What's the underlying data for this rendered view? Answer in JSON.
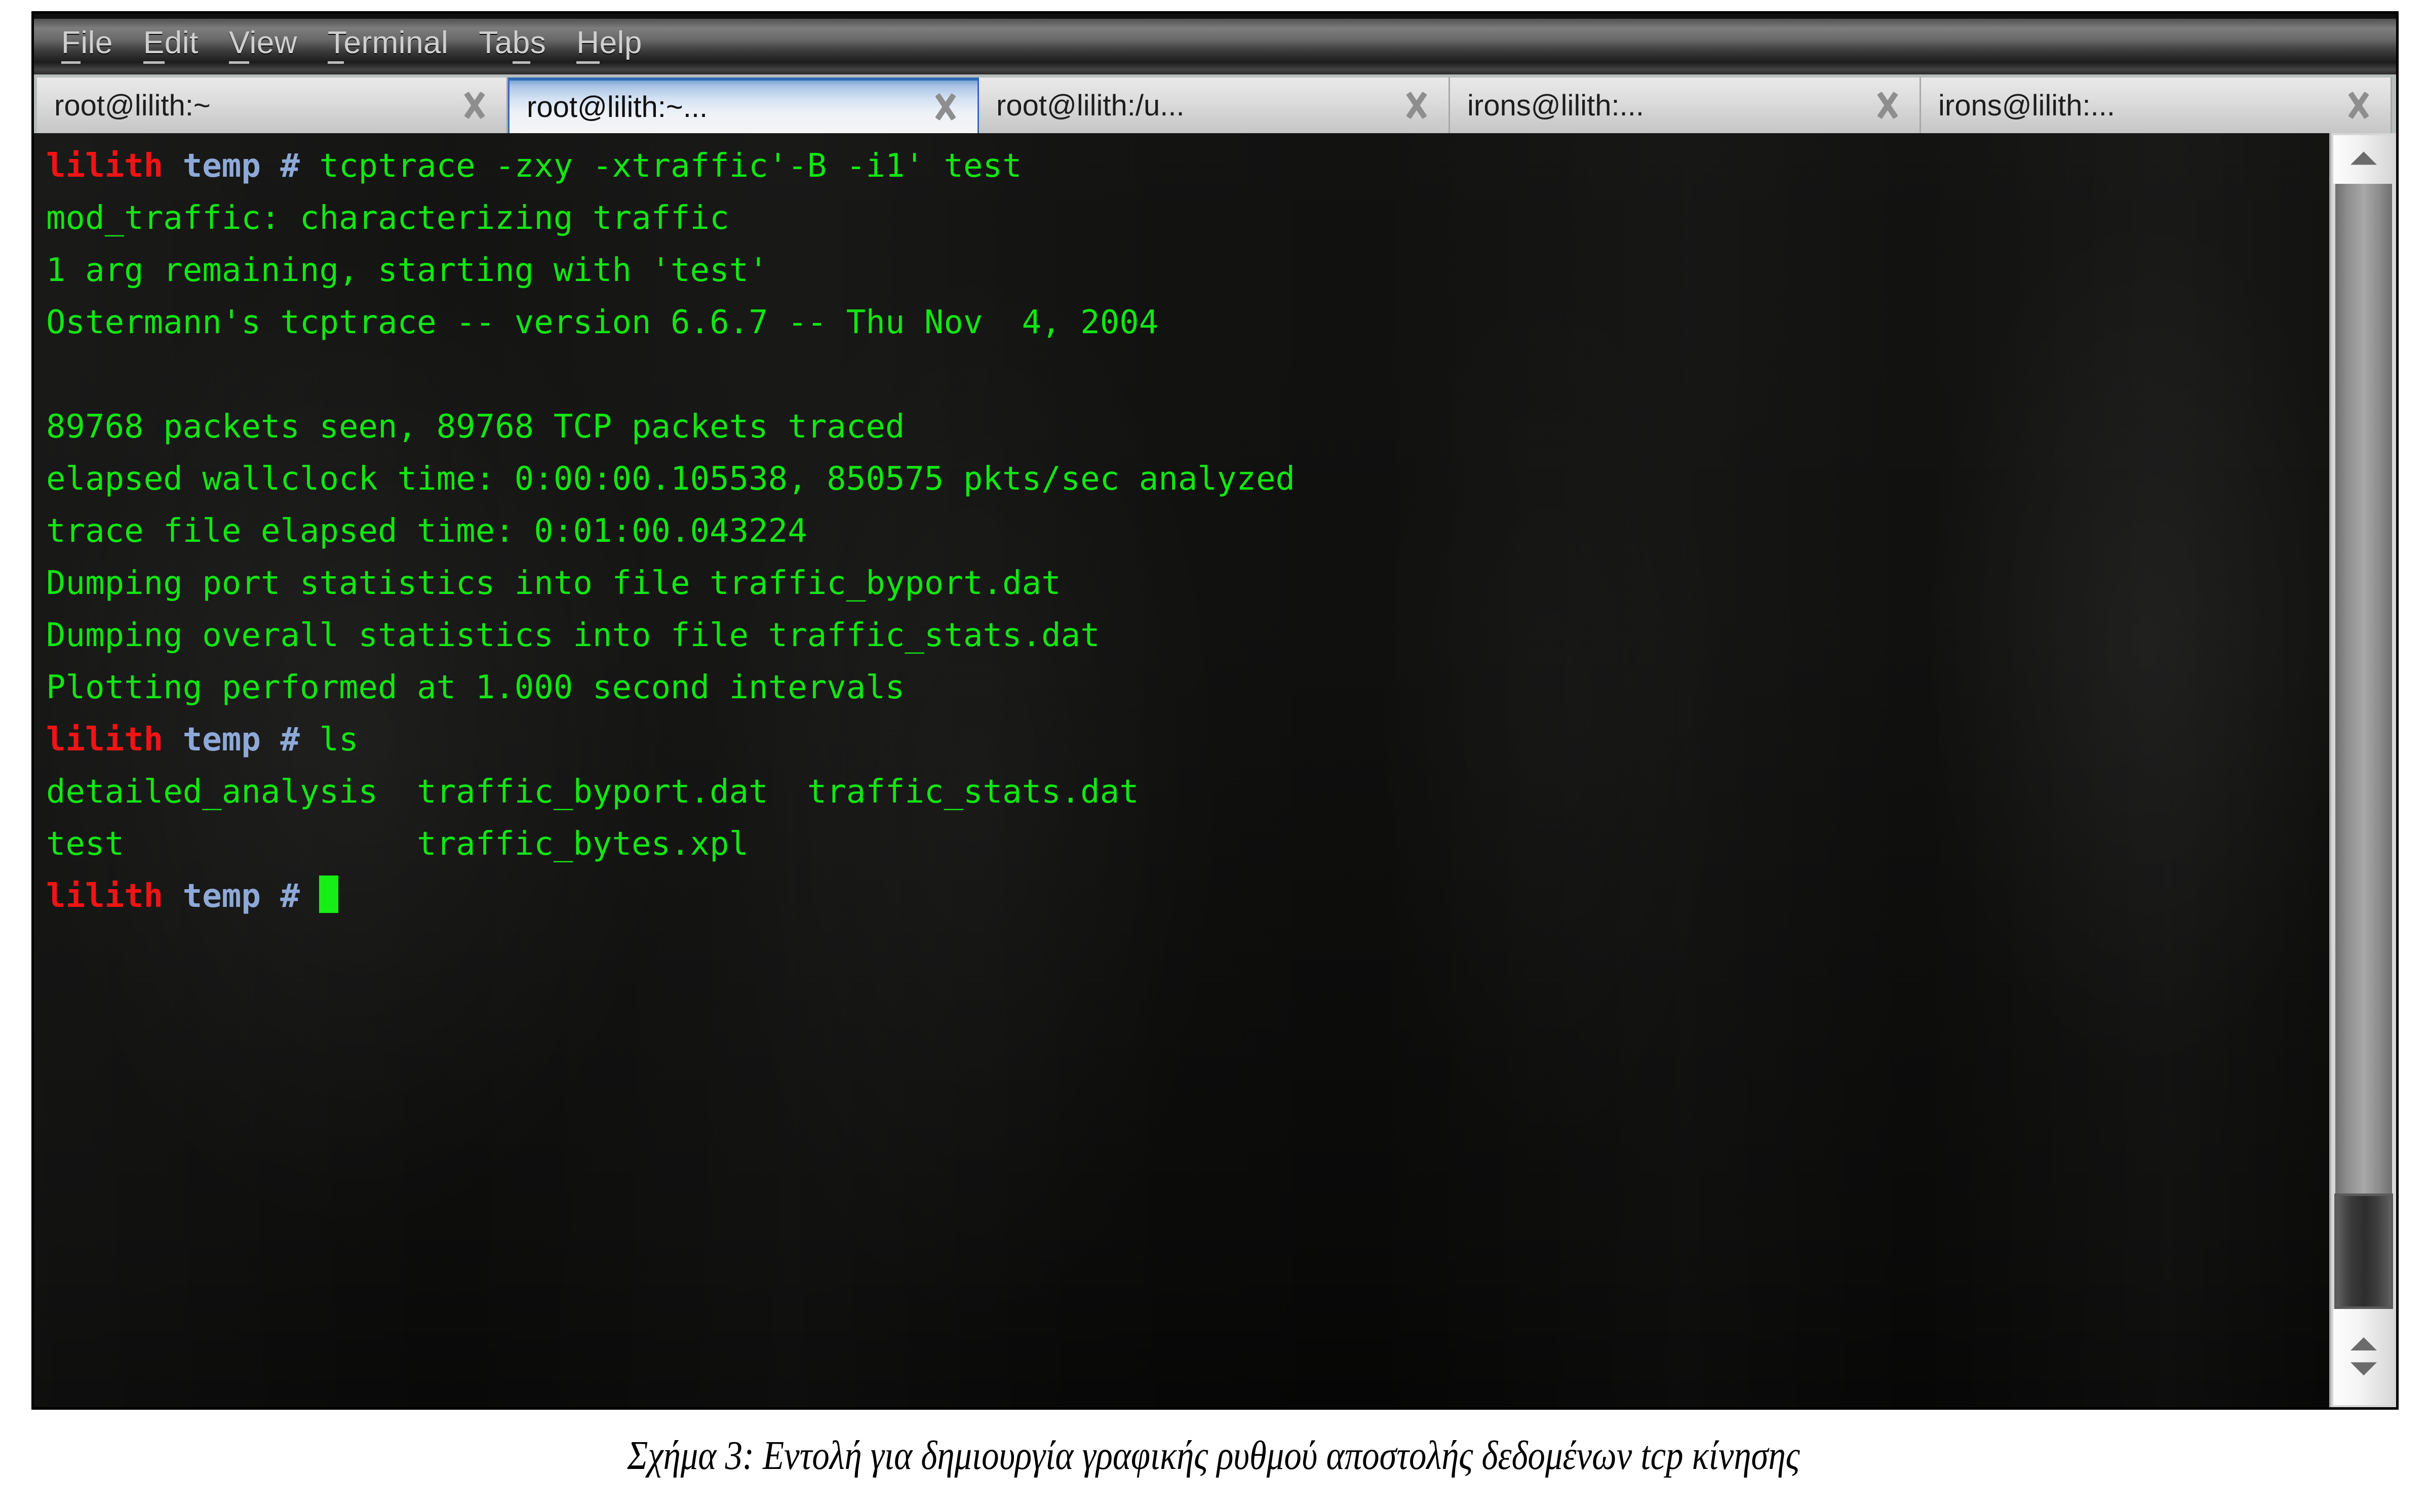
{
  "window": {
    "menubar": [
      {
        "label": "File",
        "mnemonic": "F"
      },
      {
        "label": "Edit",
        "mnemonic": "E"
      },
      {
        "label": "View",
        "mnemonic": "V"
      },
      {
        "label": "Terminal",
        "mnemonic": "T"
      },
      {
        "label": "Tabs",
        "mnemonic": "b"
      },
      {
        "label": "Help",
        "mnemonic": "H"
      }
    ],
    "tabs": [
      {
        "label": "root@lilith:~",
        "selected": false,
        "close_icon": "close-icon"
      },
      {
        "label": "root@lilith:~...",
        "selected": true,
        "close_icon": "close-icon"
      },
      {
        "label": "root@lilith:/u...",
        "selected": false,
        "close_icon": "close-icon"
      },
      {
        "label": "irons@lilith:...",
        "selected": false,
        "close_icon": "close-icon"
      },
      {
        "label": "irons@lilith:...",
        "selected": false,
        "close_icon": "close-icon"
      }
    ]
  },
  "terminal": {
    "prompt_host": "lilith",
    "prompt_cwd": "temp",
    "prompt_symbol": "#",
    "colors": {
      "host": "#f01414",
      "cwd": "#8ea9d8",
      "output": "#12e612",
      "cursor": "#15ef15",
      "background": "#0d0d0c"
    },
    "lines": [
      {
        "type": "prompt",
        "command": " tcptrace -zxy -xtraffic'-B -i1' test"
      },
      {
        "type": "output",
        "text": "mod_traffic: characterizing traffic"
      },
      {
        "type": "output",
        "text": "1 arg remaining, starting with 'test'"
      },
      {
        "type": "output",
        "text": "Ostermann's tcptrace -- version 6.6.7 -- Thu Nov  4, 2004"
      },
      {
        "type": "output",
        "text": ""
      },
      {
        "type": "output",
        "text": "89768 packets seen, 89768 TCP packets traced"
      },
      {
        "type": "output",
        "text": "elapsed wallclock time: 0:00:00.105538, 850575 pkts/sec analyzed"
      },
      {
        "type": "output",
        "text": "trace file elapsed time: 0:01:00.043224"
      },
      {
        "type": "output",
        "text": "Dumping port statistics into file traffic_byport.dat"
      },
      {
        "type": "output",
        "text": "Dumping overall statistics into file traffic_stats.dat"
      },
      {
        "type": "output",
        "text": "Plotting performed at 1.000 second intervals"
      },
      {
        "type": "prompt",
        "command": " ls"
      },
      {
        "type": "output",
        "text": "detailed_analysis  traffic_byport.dat  traffic_stats.dat"
      },
      {
        "type": "output",
        "text": "test               traffic_bytes.xpl"
      },
      {
        "type": "prompt_cursor",
        "command": " "
      }
    ]
  },
  "scrollbar": {
    "up_arrow": "scroll-up-arrow-icon",
    "down_arrow": "scroll-down-arrow-icon"
  },
  "caption": {
    "text": "Σχήμα 3: Εντολή για δημιουργία γραφικής  ρυθμού αποστολής δεδομένων  tcp κίνησης"
  }
}
